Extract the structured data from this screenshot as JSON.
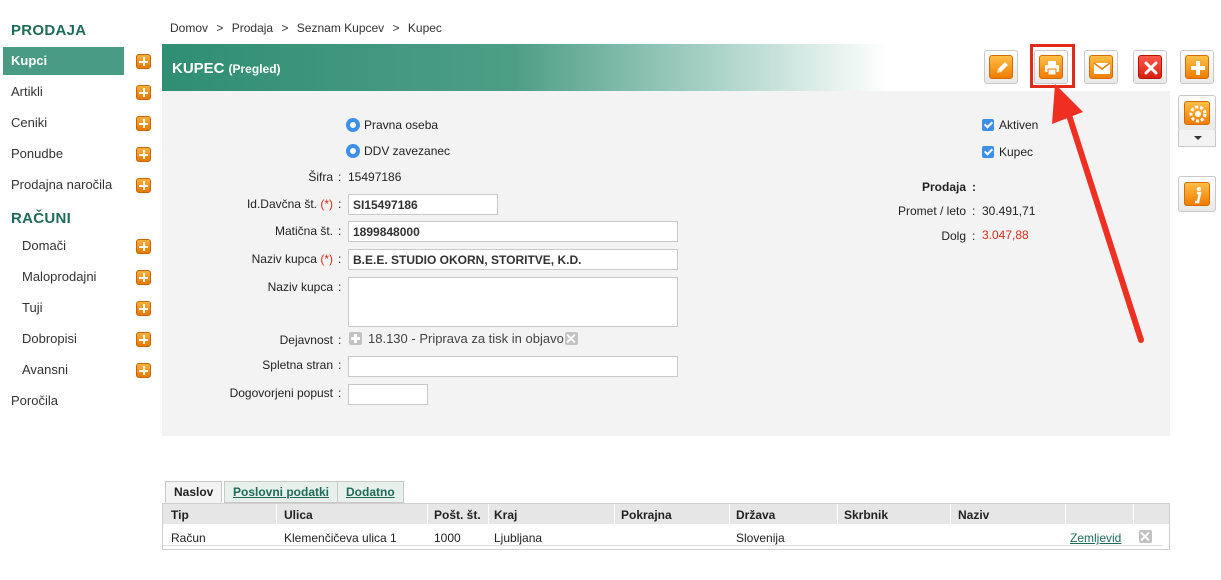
{
  "sidebar": {
    "section1_title": "PRODAJA",
    "section2_title": "RAČUNI",
    "items": [
      {
        "label": "Kupci",
        "active": true
      },
      {
        "label": "Artikli"
      },
      {
        "label": "Ceniki"
      },
      {
        "label": "Ponudbe"
      },
      {
        "label": "Prodajna naročila"
      }
    ],
    "racuni_items": [
      {
        "label": "Domači"
      },
      {
        "label": "Maloprodajni"
      },
      {
        "label": "Tuji"
      },
      {
        "label": "Dobropisi"
      },
      {
        "label": "Avansni"
      }
    ],
    "reports": "Poročila"
  },
  "breadcrumb": [
    "Domov",
    "Prodaja",
    "Seznam Kupcev",
    "Kupec"
  ],
  "breadcrumb_sep": ">",
  "header": {
    "title": "KUPEC",
    "subtitle": "(Pregled)"
  },
  "toolbar": {
    "icons": [
      "pencil-icon",
      "printer-icon",
      "envelope-icon",
      "close-icon",
      "plus-icon"
    ],
    "side_icons": [
      "gear-icon",
      "info-icon"
    ]
  },
  "colors": {
    "accent": "#4a9b84",
    "highlight": "#e02c1c",
    "orange": "#f07c00"
  },
  "form": {
    "pravna_oseba": "Pravna oseba",
    "ddv": "DDV zavezanec",
    "sifra_label": "Šifra",
    "sifra_value": "15497186",
    "id_davcna_label": "Id.Davčna št.",
    "id_davcna_value": "SI15497186",
    "maticna_label": "Matična št.",
    "maticna_value": "1899848000",
    "naziv_label": "Naziv kupca",
    "naziv_value": "B.E.E. STUDIO OKORN, STORITVE, K.D.",
    "naziv2_label": "Naziv kupca",
    "naziv2_value": "",
    "dejavnost_label": "Dejavnost",
    "dejavnost_value": "18.130 - Priprava za tisk in objavo",
    "spletna_label": "Spletna stran",
    "spletna_value": "",
    "popust_label": "Dogovorjeni popust",
    "popust_value": "",
    "required_mark": "(*)",
    "colon": ":",
    "aktiven": "Aktiven",
    "kupec": "Kupec",
    "prodaja_label": "Prodaja",
    "promet_label": "Promet / leto",
    "promet_value": "30.491,71",
    "dolg_label": "Dolg",
    "dolg_value": "3.047,88"
  },
  "tabs": [
    {
      "label": "Naslov",
      "active": true
    },
    {
      "label": "Poslovni podatki"
    },
    {
      "label": "Dodatno"
    }
  ],
  "table": {
    "columns": [
      "Tip",
      "Ulica",
      "Pošt. št.",
      "Kraj",
      "Pokrajna",
      "Država",
      "Skrbnik",
      "Naziv"
    ],
    "rows": [
      {
        "tip": "Račun",
        "ulica": "Klemenčičeva ulica 1",
        "post": "1000",
        "kraj": "Ljubljana",
        "pokrajna": "",
        "drzava": "Slovenija",
        "skrbnik": "",
        "naziv": "",
        "link": "Zemljevid"
      }
    ]
  }
}
